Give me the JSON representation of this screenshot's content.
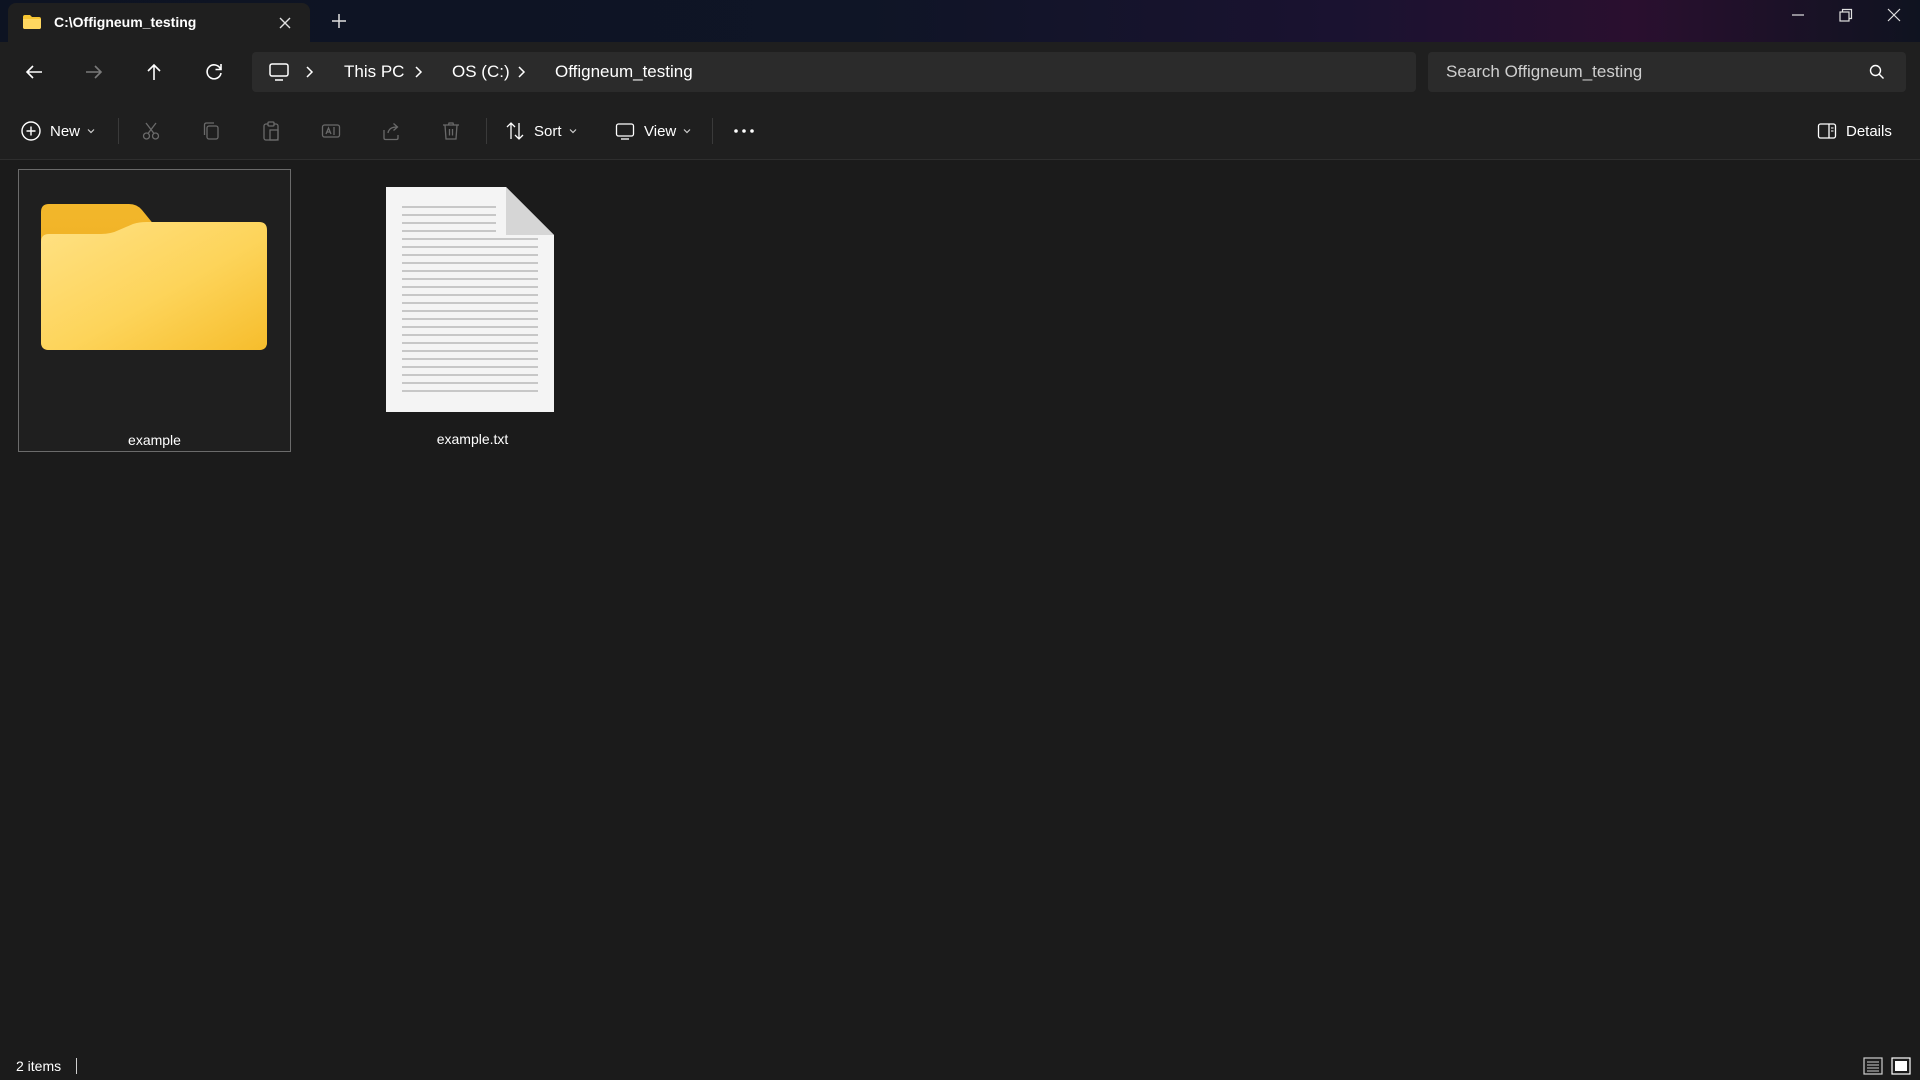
{
  "tab": {
    "title": "C:\\Offigneum_testing",
    "icon": "folder-icon"
  },
  "window_controls": [
    "minimize-icon",
    "restore-icon",
    "close-icon"
  ],
  "address": {
    "crumbs": [
      "This PC",
      "OS (C:)",
      "Offigneum_testing"
    ],
    "search_placeholder": "Search Offigneum_testing"
  },
  "commandbar": {
    "new_label": "New",
    "sort_label": "Sort",
    "view_label": "View",
    "details_label": "Details"
  },
  "items": [
    {
      "name": "example",
      "kind": "folder",
      "selected": true
    },
    {
      "name": "example.txt",
      "kind": "text-file",
      "selected": false
    }
  ],
  "status": {
    "count": "2 items"
  },
  "colors": {
    "accent_folder": "#f6c532",
    "background": "#1b1b1b",
    "chrome": "#1f1f1f",
    "input": "#2b2b2b"
  }
}
